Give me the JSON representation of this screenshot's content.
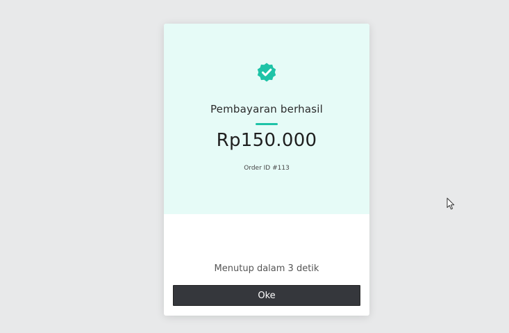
{
  "payment": {
    "title": "Pembayaran berhasil",
    "amount": "Rp150.000",
    "order_id": "Order ID #113",
    "closing_text": "Menutup dalam 3 detik",
    "ok_label": "Oke"
  },
  "icons": {
    "badge": "check-badge-icon",
    "cursor": "mouse-pointer-icon"
  },
  "colors": {
    "accent": "#1ec3a7",
    "card_top_bg": "#e6fbf7",
    "button_bg": "#35373c",
    "page_bg": "#e8e9ea"
  }
}
